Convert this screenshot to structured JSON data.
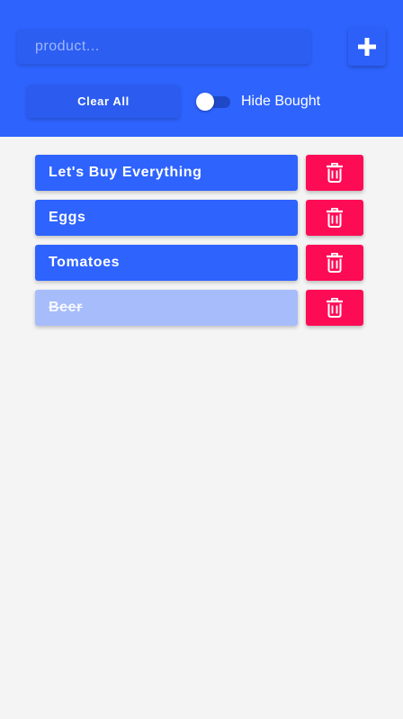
{
  "colors": {
    "accent": "#2e63fe",
    "delete": "#fe0b56",
    "bought_item": "#a7bcfb",
    "background": "#f4f4f4"
  },
  "header": {
    "search": {
      "placeholder": "product...",
      "value": ""
    },
    "add_button": {
      "icon": "plus-icon"
    },
    "clear_all_label": "Clear All",
    "hide_bought": {
      "label": "Hide Bought",
      "enabled": false
    }
  },
  "items": [
    {
      "label": "Let's Buy Everything",
      "bought": false,
      "delete_icon": "trash-icon"
    },
    {
      "label": "Eggs",
      "bought": false,
      "delete_icon": "trash-icon"
    },
    {
      "label": "Tomatoes",
      "bought": false,
      "delete_icon": "trash-icon"
    },
    {
      "label": "Beer",
      "bought": true,
      "delete_icon": "trash-icon"
    }
  ]
}
